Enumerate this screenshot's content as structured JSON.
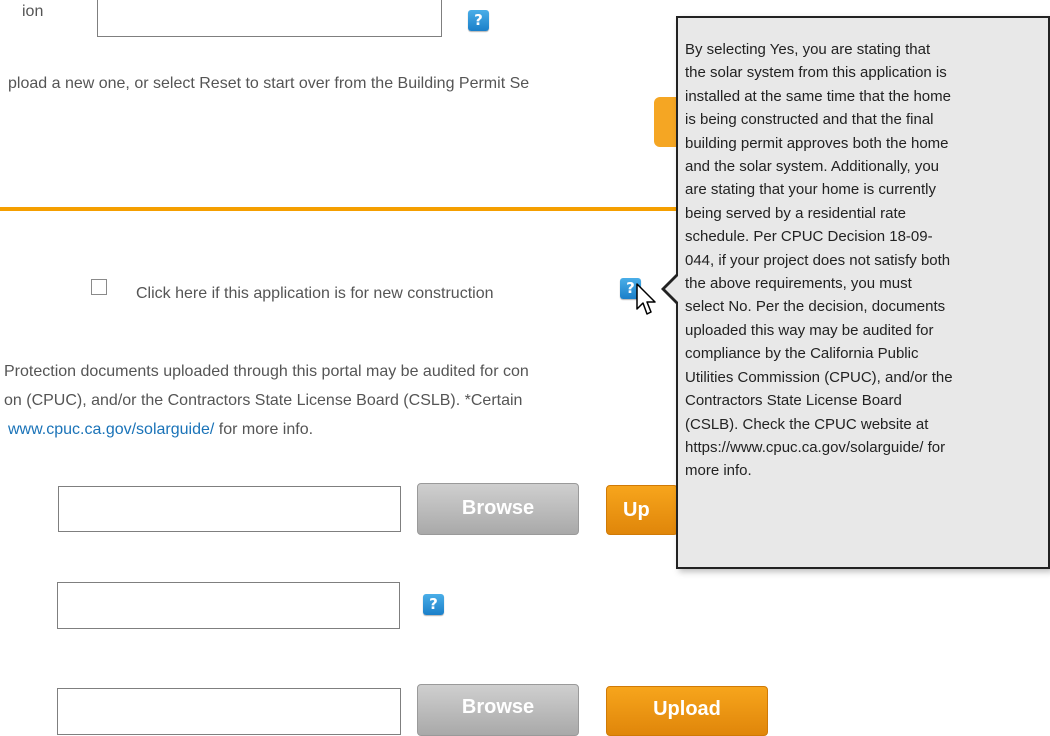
{
  "form": {
    "top_label_fragment": "ion",
    "upload_instruction": "pload a new one, or select Reset to start over from the Building Permit Se",
    "new_construction_label": "Click here if this application is for new construction",
    "notice_line1": "Protection documents uploaded through this portal may be audited for con",
    "notice_line2": "on (CPUC), and/or the Contractors State License Board (CSLB). *Certain",
    "notice_link": "www.cpuc.ca.gov/solarguide/",
    "notice_line3_suffix": " for more info.",
    "browse_label": "Browse",
    "upload_label_partial": "Up",
    "upload_label": "Upload",
    "help_icon_glyph": "?"
  },
  "tooltip": {
    "lines": [
      "By selecting Yes, you are stating that",
      "the solar system from this application is",
      "installed at the same time that the home",
      "is being constructed and that the final",
      "building permit approves both the home",
      "and the solar system. Additionally, you",
      "are stating that your home is currently",
      "being served by a residential rate",
      "schedule. Per CPUC Decision 18-09-",
      "044, if your project does not satisfy both",
      "the above requirements, you must",
      "select No. Per the decision, documents",
      "uploaded this way may be audited for",
      "compliance by the California Public",
      "Utilities Commission (CPUC), and/or the",
      "Contractors State License Board",
      "(CSLB). Check the CPUC website at",
      "https://www.cpuc.ca.gov/solarguide/ for",
      "more info."
    ]
  },
  "colors": {
    "accent_orange": "#f59f00",
    "help_blue": "#1a7fc9",
    "link_blue": "#1a73b8",
    "tooltip_bg": "#e8e8e8"
  }
}
